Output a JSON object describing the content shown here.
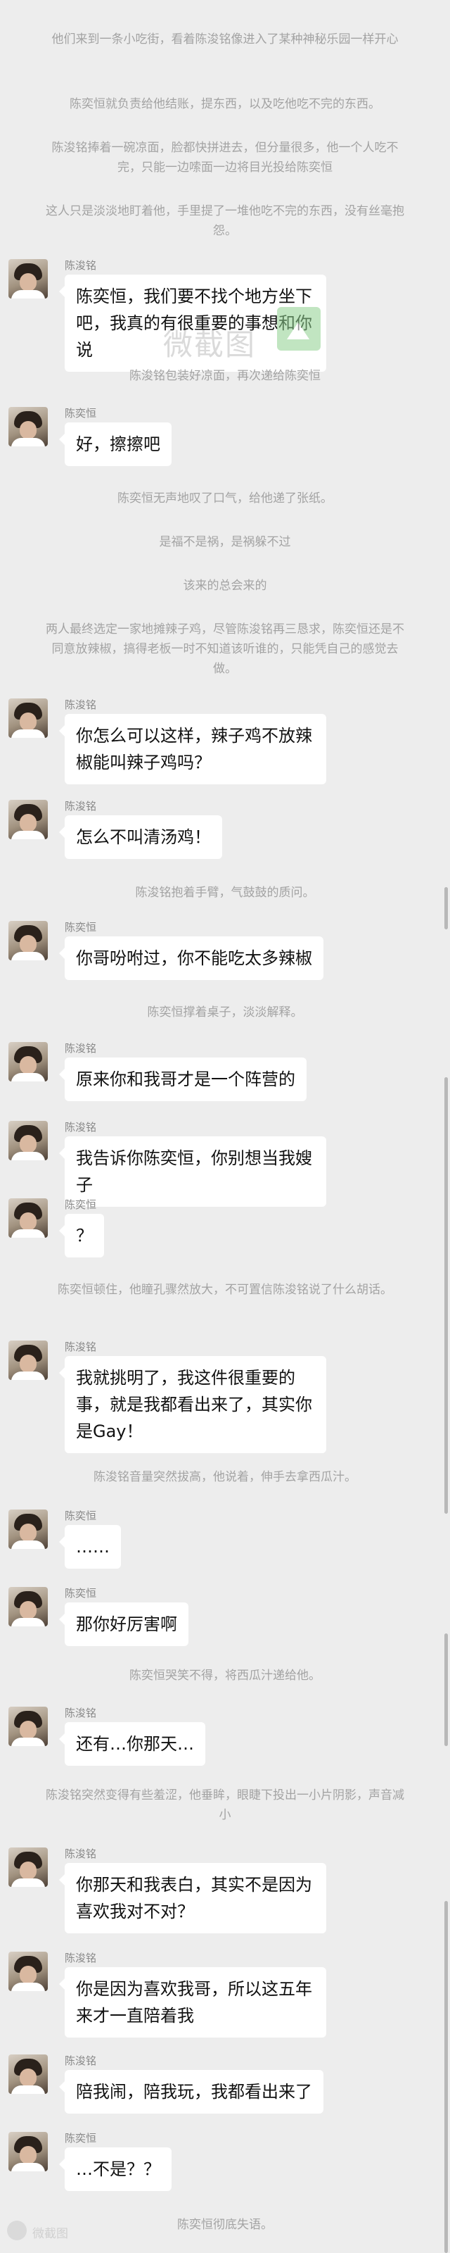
{
  "narration": [
    "他们来到一条小吃街，看着陈浚铭像进入了某种神秘乐园一样开心",
    "陈奕恒就负责给他结账，提东西，以及吃他吃不完的东西。",
    "陈浚铭捧着一碗凉面，脸都快拼进去，但分量很多，他一个人吃不完，只能一边嗦面一边将目光投给陈奕恒",
    "这人只是淡淡地盯着他，手里提了一堆他吃不完的东西，没有丝毫抱怨。",
    "陈浚铭包装好凉面，再次递给陈奕恒",
    "陈奕恒无声地叹了口气，给他递了张纸。",
    "是福不是祸，是祸躲不过",
    "该来的总会来的",
    "两人最终选定一家地摊辣子鸡，尽管陈浚铭再三恳求，陈奕恒还是不同意放辣椒，搞得老板一时不知道该听谁的，只能凭自己的感觉去做。",
    "陈浚铭抱着手臂，气鼓鼓的质问。",
    "陈奕恒撑着桌子，淡淡解释。",
    "陈奕恒顿住，他瞳孔骤然放大，不可置信陈浚铭说了什么胡话。",
    "陈浚铭音量突然拔高，他说着，伸手去拿西瓜汁。",
    "陈奕恒哭笑不得，将西瓜汁递给他。",
    "陈浚铭突然变得有些羞涩，他垂眸，眼睫下投出一小片阴影，声音减小",
    "陈奕恒彻底失语。"
  ],
  "messages": [
    {
      "sender": "陈浚铭",
      "text": "陈奕恒，我们要不找个地方坐下吧，我真的有很重要的事想和你说"
    },
    {
      "sender": "陈奕恒",
      "text": "好，擦擦吧"
    },
    {
      "sender": "陈浚铭",
      "text": "你怎么可以这样，辣子鸡不放辣椒能叫辣子鸡吗？"
    },
    {
      "sender": "陈浚铭",
      "text": "怎么不叫清汤鸡！"
    },
    {
      "sender": "陈奕恒",
      "text": "你哥吩咐过，你不能吃太多辣椒"
    },
    {
      "sender": "陈浚铭",
      "text": "原来你和我哥才是一个阵营的"
    },
    {
      "sender": "陈浚铭",
      "text": "我告诉你陈奕恒，你别想当我嫂子"
    },
    {
      "sender": "陈奕恒",
      "text": "？"
    },
    {
      "sender": "陈浚铭",
      "text": "我就挑明了，我这件很重要的事，就是我都看出来了，其实你是Gay！"
    },
    {
      "sender": "陈奕恒",
      "text": "……"
    },
    {
      "sender": "陈奕恒",
      "text": "那你好厉害啊"
    },
    {
      "sender": "陈浚铭",
      "text": "还有…你那天…"
    },
    {
      "sender": "陈浚铭",
      "text": "你那天和我表白，其实不是因为喜欢我对不对？"
    },
    {
      "sender": "陈浚铭",
      "text": "你是因为喜欢我哥，所以这五年来才一直陪着我"
    },
    {
      "sender": "陈浚铭",
      "text": "陪我闹，陪我玩，我都看出来了"
    },
    {
      "sender": "陈奕恒",
      "text": "…不是？？"
    }
  ],
  "watermarks": {
    "top": "微截图",
    "bottom": "微截图"
  },
  "icons": {
    "avatar": "avatar-icon",
    "watermark_logo": "image-icon"
  },
  "colors": {
    "background": "#ededed",
    "bubble": "#ffffff",
    "narration": "#a3a3a3"
  }
}
